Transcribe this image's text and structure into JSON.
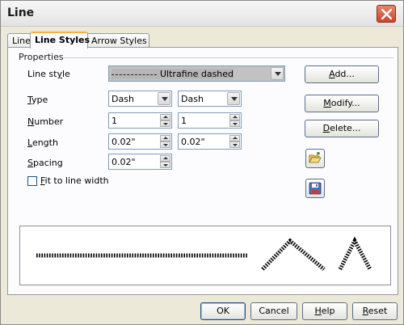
{
  "window": {
    "title": "Line"
  },
  "tabs": [
    {
      "label": "Line",
      "active": false
    },
    {
      "label": "Line Styles",
      "active": true
    },
    {
      "label": "Arrow Styles",
      "active": false
    }
  ],
  "properties": {
    "group_label": "Properties",
    "line_style": {
      "label_pre": "Line st",
      "label_u": "y",
      "label_post": "le",
      "value": "Ultrafine dashed"
    },
    "type": {
      "label_u": "T",
      "label_post": "ype",
      "value1": "Dash",
      "value2": "Dash"
    },
    "number": {
      "label_u": "N",
      "label_post": "umber",
      "value1": "1",
      "value2": "1"
    },
    "length": {
      "label_u": "L",
      "label_post": "ength",
      "value1": "0.02\"",
      "value2": "0.02\""
    },
    "spacing": {
      "label_u": "S",
      "label_post": "pacing",
      "value": "0.02\""
    },
    "fit_to_line_width": {
      "label_u": "F",
      "label_post": "it to line width",
      "checked": false
    }
  },
  "side_buttons": {
    "add": {
      "pre": "",
      "u": "A",
      "post": "dd..."
    },
    "modify": {
      "pre": "",
      "u": "M",
      "post": "odify..."
    },
    "delete": {
      "pre": "",
      "u": "D",
      "post": "elete..."
    },
    "load_icon": "folder-open-icon",
    "save_icon": "floppy-disk-icon"
  },
  "footer": {
    "ok": "OK",
    "cancel": "Cancel",
    "help": {
      "u": "H",
      "post": "elp"
    },
    "reset": {
      "u": "R",
      "post": "eset"
    }
  },
  "colors": {
    "dialog_bg": "#ece9d8",
    "tab_accent": "#f7b142",
    "close_button": "#c8472b"
  }
}
